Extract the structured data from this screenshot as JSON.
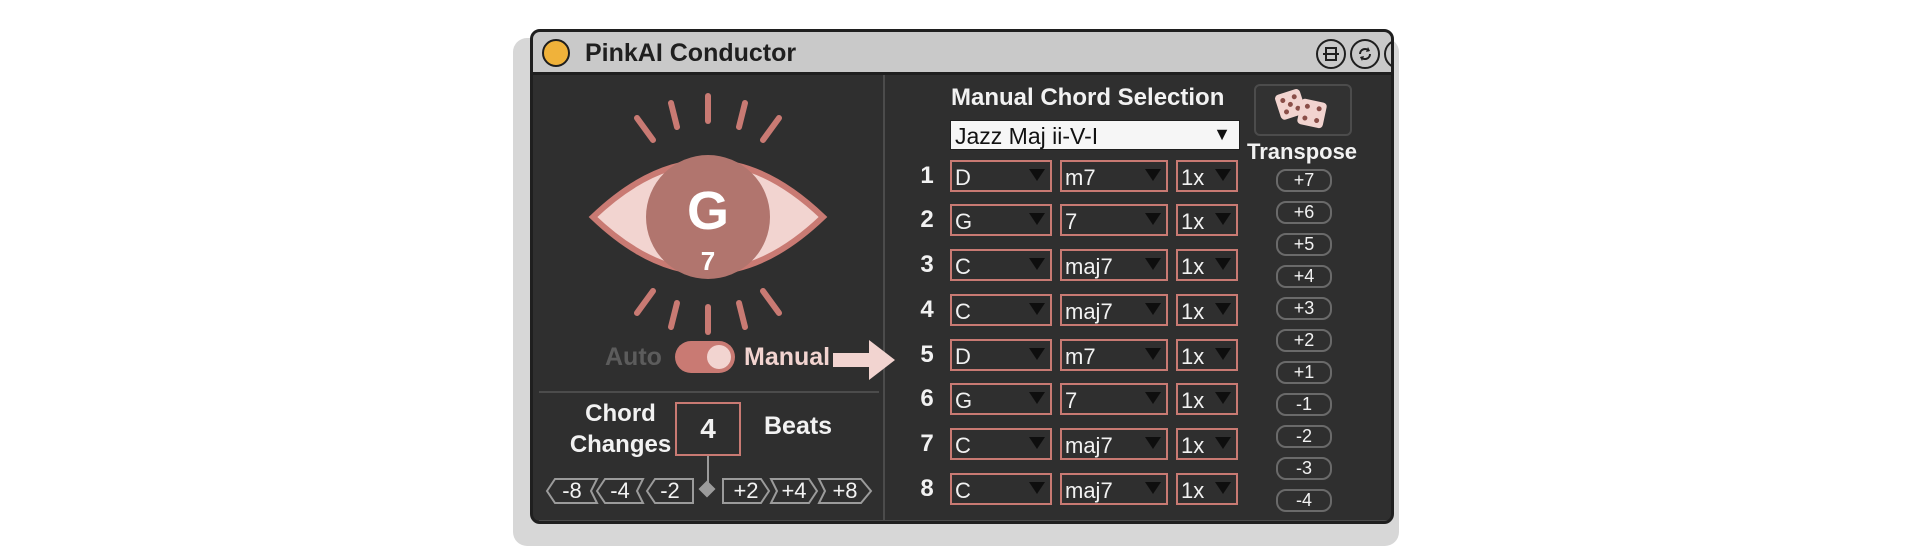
{
  "window": {
    "title": "PinkAI Conductor"
  },
  "eye": {
    "root": "G",
    "quality": "7"
  },
  "mode": {
    "auto_label": "Auto",
    "manual_label": "Manual",
    "selected": "Manual"
  },
  "chord_changes": {
    "label_line1": "Chord",
    "label_line2": "Changes",
    "value": "4",
    "unit": "Beats",
    "steps": [
      "-8",
      "-4",
      "-2",
      "+2",
      "+4",
      "+8"
    ]
  },
  "manual": {
    "title": "Manual Chord Selection",
    "preset": "Jazz Maj ii-V-I",
    "rows": [
      {
        "num": "1",
        "root": "D",
        "quality": "m7",
        "mult": "1x"
      },
      {
        "num": "2",
        "root": "G",
        "quality": "7",
        "mult": "1x"
      },
      {
        "num": "3",
        "root": "C",
        "quality": "maj7",
        "mult": "1x"
      },
      {
        "num": "4",
        "root": "C",
        "quality": "maj7",
        "mult": "1x"
      },
      {
        "num": "5",
        "root": "D",
        "quality": "m7",
        "mult": "1x"
      },
      {
        "num": "6",
        "root": "G",
        "quality": "7",
        "mult": "1x"
      },
      {
        "num": "7",
        "root": "C",
        "quality": "maj7",
        "mult": "1x"
      },
      {
        "num": "8",
        "root": "C",
        "quality": "maj7",
        "mult": "1x"
      }
    ]
  },
  "transpose": {
    "label": "Transpose",
    "values": [
      "+7",
      "+6",
      "+5",
      "+4",
      "+3",
      "+2",
      "+1",
      "-1",
      "-2",
      "-3",
      "-4"
    ]
  },
  "icons": {
    "power": "power-icon",
    "dice": "dice-icon",
    "arrow": "arrow-right-icon"
  },
  "colors": {
    "accent": "#c97a73",
    "accent_light": "#f2d4d0",
    "panel": "#2f2f2f",
    "power": "#f0b23a"
  }
}
